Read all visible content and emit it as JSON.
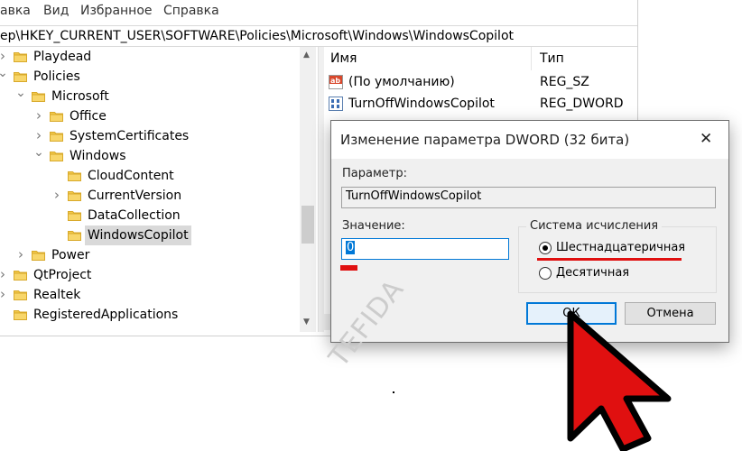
{
  "menubar": {
    "items": [
      "авка",
      "Вид",
      "Избранное",
      "Справка"
    ]
  },
  "address": {
    "path": "ер\\HKEY_CURRENT_USER\\SOFTWARE\\Policies\\Microsoft\\Windows\\WindowsCopilot"
  },
  "tree": {
    "items": [
      {
        "label": "Playdead",
        "expander": ">"
      },
      {
        "label": "Policies",
        "expander": "v"
      },
      {
        "label": "Microsoft",
        "expander": "v"
      },
      {
        "label": "Office",
        "expander": ">"
      },
      {
        "label": "SystemCertificates",
        "expander": ">"
      },
      {
        "label": "Windows",
        "expander": "v"
      },
      {
        "label": "CloudContent",
        "expander": ""
      },
      {
        "label": "CurrentVersion",
        "expander": ">"
      },
      {
        "label": "DataCollection",
        "expander": ""
      },
      {
        "label": "WindowsCopilot",
        "expander": ""
      },
      {
        "label": "Power",
        "expander": ">"
      },
      {
        "label": "QtProject",
        "expander": ">"
      },
      {
        "label": "Realtek",
        "expander": ">"
      },
      {
        "label": "RegisteredApplications",
        "expander": ""
      }
    ],
    "selected": "WindowsCopilot"
  },
  "list": {
    "col_name": "Имя",
    "col_type": "Тип",
    "rows": [
      {
        "name": "(По умолчанию)",
        "type": "REG_SZ",
        "icon": "string-value-icon"
      },
      {
        "name": "TurnOffWindowsCopilot",
        "type": "REG_DWORD",
        "icon": "dword-value-icon"
      }
    ]
  },
  "dialog": {
    "title": "Изменение параметра DWORD (32 бита)",
    "close_glyph": "✕",
    "param_label": "Параметр:",
    "param_value": "TurnOffWindowsCopilot",
    "value_label": "Значение:",
    "value": "0",
    "base_group_label": "Система исчисления",
    "hex_label": "Шестнадцатеричная",
    "dec_label": "Десятичная",
    "selected_base": "hex",
    "ok_label": "ОК",
    "cancel_label": "Отмена"
  },
  "watermark": "TEFIDA",
  "colors": {
    "accent": "#0078d7",
    "highlight": "#e01010",
    "folder": "#f2c84b",
    "selection": "#d9d9d9"
  }
}
